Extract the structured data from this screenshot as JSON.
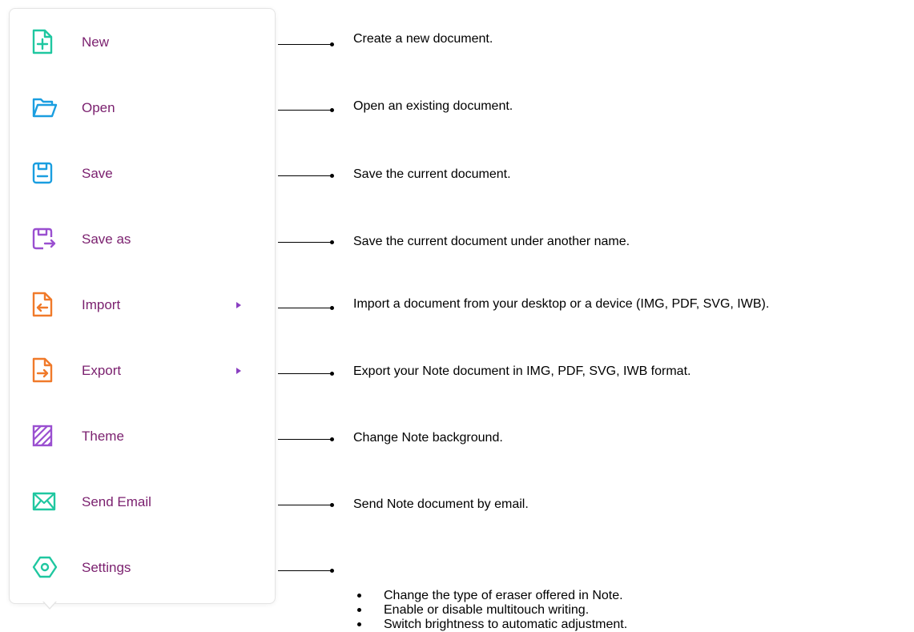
{
  "menu": {
    "items": [
      {
        "label": "New",
        "icon": "new-document-icon",
        "color": "#1fc7a0"
      },
      {
        "label": "Open",
        "icon": "folder-open-icon",
        "color": "#1a9ee0"
      },
      {
        "label": "Save",
        "icon": "save-icon",
        "color": "#1a9ee0"
      },
      {
        "label": "Save as",
        "icon": "save-as-icon",
        "color": "#9a4fd0"
      },
      {
        "label": "Import",
        "icon": "import-icon",
        "color": "#f07a2a",
        "has_submenu": true
      },
      {
        "label": "Export",
        "icon": "export-icon",
        "color": "#f07a2a",
        "has_submenu": true
      },
      {
        "label": "Theme",
        "icon": "theme-icon",
        "color": "#9a4fd0"
      },
      {
        "label": "Send Email",
        "icon": "email-icon",
        "color": "#1fc7a0"
      },
      {
        "label": "Settings",
        "icon": "settings-icon",
        "color": "#1fc7a0"
      }
    ],
    "label_color": "#7a1f6e",
    "submenu_arrow_color": "#8a3fc1"
  },
  "descriptions": [
    "Create a new document.",
    "Open an existing document.",
    "Save the current document.",
    "Save the current document under another name.",
    "Import a document from your desktop or a device (IMG, PDF, SVG, IWB).",
    "Export your Note document in IMG, PDF, SVG, IWB format.",
    "Change Note background.",
    "Send Note document by email."
  ],
  "settings_bullets": [
    "Change the type of eraser offered in Note.",
    "Enable or disable multitouch writing.",
    "Switch brightness to automatic adjustment."
  ]
}
